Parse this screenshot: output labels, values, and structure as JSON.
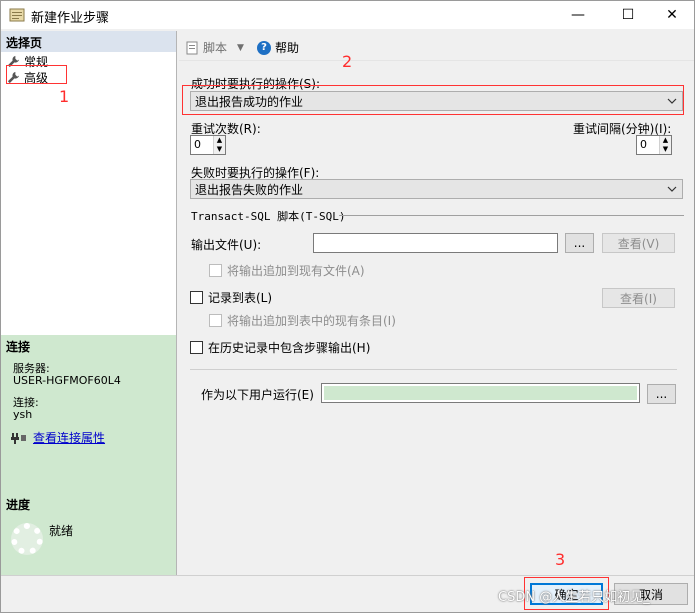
{
  "window": {
    "title": "新建作业步骤",
    "minimize": "—",
    "maximize": "☐",
    "close": "✕"
  },
  "left": {
    "pages_header": "选择页",
    "pages": [
      {
        "label": "常规",
        "icon": "wrench-icon"
      },
      {
        "label": "高级",
        "icon": "wrench-icon"
      }
    ],
    "connection_header": "连接",
    "server_label": "服务器:",
    "server_value": "USER-HGFMOF60L4",
    "connection_label": "连接:",
    "connection_value": "ysh",
    "view_props_link": "查看连接属性",
    "progress_header": "进度",
    "progress_status": "就绪"
  },
  "toolbar": {
    "script_label": "脚本",
    "help_label": "帮助"
  },
  "form": {
    "on_success_label": "成功时要执行的操作(S):",
    "on_success_value": "退出报告成功的作业",
    "retry_count_label": "重试次数(R):",
    "retry_count_value": "0",
    "retry_interval_label": "重试间隔(分钟)(I):",
    "retry_interval_value": "0",
    "on_failure_label": "失败时要执行的操作(F):",
    "on_failure_value": "退出报告失败的作业",
    "tsql_section": "Transact-SQL 脚本(T-SQL)",
    "output_file_label": "输出文件(U):",
    "browse_label": "...",
    "view_label": "查看(V)",
    "append_output_label": "将输出追加到现有文件(A)",
    "log_to_table_label": "记录到表(L)",
    "view_table_label": "查看(I)",
    "append_table_label": "将输出追加到表中的现有条目(I)",
    "include_history_label": "在历史记录中包含步骤输出(H)",
    "run_as_label": "作为以下用户运行(E)",
    "run_as_browse": "..."
  },
  "buttons": {
    "ok": "确定",
    "cancel": "取消"
  },
  "annotations": {
    "n1": "1",
    "n2": "2",
    "n3": "3"
  },
  "watermark": "CSDN @人生若只如初见_"
}
